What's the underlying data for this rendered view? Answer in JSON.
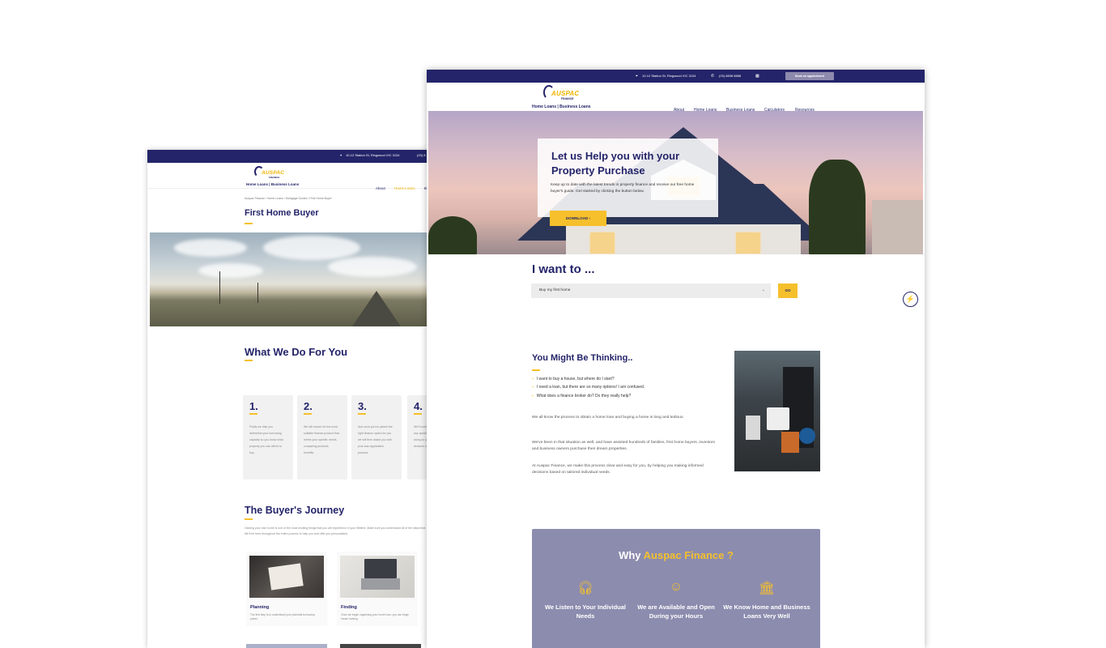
{
  "back_page": {
    "topbar": {
      "address": "10-12 Station St, Ringwood VIC 3134",
      "phone": "(03) 8"
    },
    "logo": {
      "word": "AUSPAC",
      "word2": "FINANCE",
      "sub": "Home Loans | Business Loans"
    },
    "nav": [
      "About",
      "Home Loans",
      "B"
    ],
    "breadcrumb": "Auspac Finance / Home Loans / Mortgage Guides / First Home Buyer",
    "title": "First Home Buyer",
    "what_title": "What We Do For You",
    "steps": [
      {
        "num": "1.",
        "text": "Firstly we help you determine your borrowing capacity so you know what property you can afford to buy."
      },
      {
        "num": "2.",
        "text": "We will search for the most suitable finance product that meets your specific needs, comparing products benefits."
      },
      {
        "num": "3.",
        "text": "And once you've picked the right finance option for you we will then assist you with your loan application process."
      },
      {
        "num": "4.",
        "text": "We'll continue to answer any questions thinking along so you can make a decision on home loan."
      }
    ],
    "journey_title": "The Buyer's Journey",
    "journey_intro": "Owning your own home is one of the most exciting things that you will experience in your lifetime. Make sure you understand all of the steps that. We'll be here throughout the entire process to help you and offer you personalised",
    "journey": [
      {
        "title": "Planning",
        "text": "The first step is to understand your potential borrowing power."
      },
      {
        "title": "Finding",
        "text": "Once we begin organising your home loan, you can begin house hunting."
      }
    ]
  },
  "front_page": {
    "topbar": {
      "address": "10-12 Station St, Ringwood VIC 3134",
      "phone": "(03) 8838 8888",
      "appointment": "Book an appointment"
    },
    "logo": {
      "word": "AUSPAC",
      "word2": "FINANCE",
      "sub": "Home Loans | Business Loans"
    },
    "nav": [
      "About",
      "Home Loans",
      "Business Loans",
      "Calculators",
      "Resources"
    ],
    "hero": {
      "title": "Let us Help you with your Property Purchase",
      "body": "Keep up to date with the latest trends in property finance and receive our free home buyer's guide. Get started by clicking the button below.",
      "button": "DOWNLOAD ›"
    },
    "want": {
      "title": "I want to ...",
      "selected": "Buy my first home",
      "go": "GO"
    },
    "thinking": {
      "title": "You Might Be Thinking..",
      "bullets": [
        "I want to buy a house, but where do I start?",
        "I need a loan, but there are so many options! I am confused.",
        "What does a finance broker do? Do they really help?"
      ],
      "paragraphs": [
        "We all know the process to obtain a home loan and buying a home is long and tedious.",
        "We've been in that situation as well, and have assisted hundreds of families, first home buyers, investors and business owners purchase their dream properties.",
        "At Auspac Finance, we make this process clear and easy for you, by helping you making informed decisions based on tailored individual needs."
      ]
    },
    "why": {
      "title_pre": "Why ",
      "title_brand": "Auspac Finance ?",
      "features": [
        {
          "icon": "headphones-icon",
          "label": "We Listen to Your Individual Needs"
        },
        {
          "icon": "smiley-icon",
          "label": "We are Available and Open During your Hours"
        },
        {
          "icon": "bank-icon",
          "label": "We Know Home and Business Loans Very Well"
        }
      ]
    }
  },
  "colors": {
    "navy": "#24246a",
    "yellow": "#f5c02b",
    "why_bg": "#8c8caf"
  }
}
